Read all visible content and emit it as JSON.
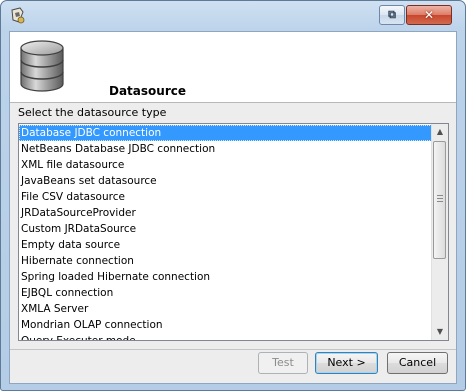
{
  "window": {
    "close_label": "✕",
    "restore_label": "⧉",
    "app_icon": "report-designer-icon"
  },
  "header": {
    "title": "Datasource",
    "icon": "database-icon"
  },
  "prompt": "Select the datasource type",
  "datasource_types": [
    "Database JDBC connection",
    "NetBeans Database JDBC connection",
    "XML file datasource",
    "JavaBeans set datasource",
    "File CSV datasource",
    "JRDataSourceProvider",
    "Custom JRDataSource",
    "Empty data source",
    "Hibernate connection",
    "Spring loaded Hibernate connection",
    "EJBQL connection",
    "XMLA Server",
    "Mondrian OLAP connection",
    "Query Executer mode"
  ],
  "selected_index": 0,
  "scrollbar": {
    "up_arrow": "▲",
    "down_arrow": "▼"
  },
  "buttons": {
    "test": "Test",
    "next": "Next >",
    "cancel": "Cancel"
  },
  "colors": {
    "selection": "#3399ff",
    "title_bar": "#bcd3ea",
    "close_button": "#c8462c"
  }
}
